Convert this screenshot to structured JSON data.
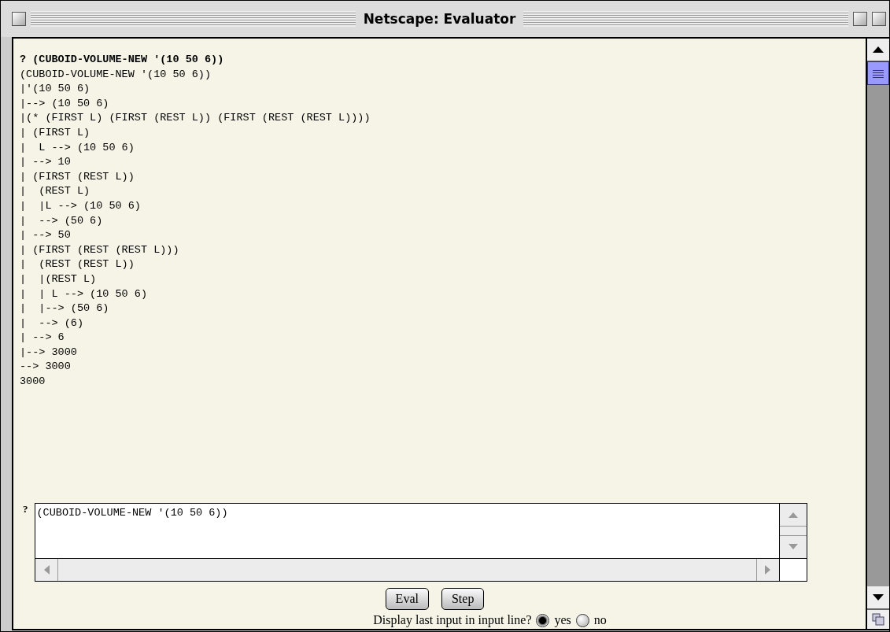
{
  "window": {
    "title": "Netscape: Evaluator"
  },
  "transcript": [
    {
      "text": "? (CUBOID-VOLUME-NEW '(10 50 6))",
      "kind": "input"
    },
    {
      "text": "(CUBOID-VOLUME-NEW '(10 50 6))",
      "kind": "trace"
    },
    {
      "text": "|'(10 50 6)",
      "kind": "trace"
    },
    {
      "text": "|--> (10 50 6)",
      "kind": "trace"
    },
    {
      "text": "|(* (FIRST L) (FIRST (REST L)) (FIRST (REST (REST L))))",
      "kind": "trace"
    },
    {
      "text": "| (FIRST L)",
      "kind": "trace"
    },
    {
      "text": "|  L --> (10 50 6)",
      "kind": "trace"
    },
    {
      "text": "| --> 10",
      "kind": "trace"
    },
    {
      "text": "| (FIRST (REST L))",
      "kind": "trace"
    },
    {
      "text": "|  (REST L)",
      "kind": "trace"
    },
    {
      "text": "|  |L --> (10 50 6)",
      "kind": "trace"
    },
    {
      "text": "|  --> (50 6)",
      "kind": "trace"
    },
    {
      "text": "| --> 50",
      "kind": "trace"
    },
    {
      "text": "| (FIRST (REST (REST L)))",
      "kind": "trace"
    },
    {
      "text": "|  (REST (REST L))",
      "kind": "trace"
    },
    {
      "text": "|  |(REST L)",
      "kind": "trace"
    },
    {
      "text": "|  | L --> (10 50 6)",
      "kind": "trace"
    },
    {
      "text": "|  |--> (50 6)",
      "kind": "trace"
    },
    {
      "text": "|  --> (6)",
      "kind": "trace"
    },
    {
      "text": "| --> 6",
      "kind": "trace"
    },
    {
      "text": "|--> 3000",
      "kind": "trace"
    },
    {
      "text": "--> 3000",
      "kind": "trace"
    },
    {
      "text": "3000",
      "kind": "trace"
    }
  ],
  "input": {
    "prompt": "?",
    "value": "(CUBOID-VOLUME-NEW '(10 50 6))"
  },
  "buttons": [
    "Eval",
    "Step"
  ],
  "display_option": {
    "label": "Display last input in input line?",
    "options": [
      {
        "label": "yes",
        "selected": true
      },
      {
        "label": "no",
        "selected": false
      }
    ]
  }
}
